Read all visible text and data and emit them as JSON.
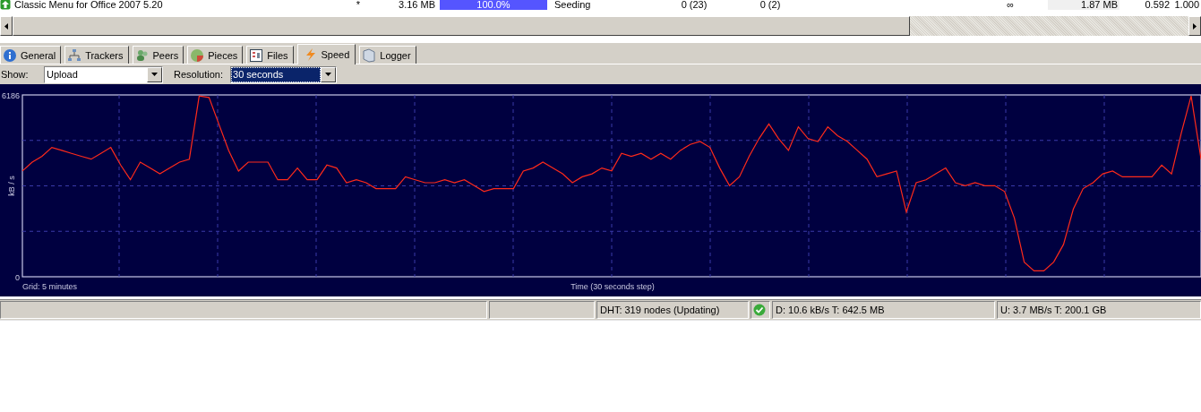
{
  "torrent_row": {
    "name": "Classic Menu for Office 2007 5.20",
    "priority": "*",
    "size": "3.16 MB",
    "progress": {
      "level": 1,
      "text": "100.0%"
    },
    "status": "Seeding",
    "seeds": "0 (23)",
    "peers": "0 (2)",
    "eta": "∞",
    "uploaded": "1.87 MB",
    "ratio": "0.592",
    "availability": "1.000"
  },
  "tabs": [
    {
      "label": "General",
      "selected": false
    },
    {
      "label": "Trackers",
      "selected": false
    },
    {
      "label": "Peers",
      "selected": false
    },
    {
      "label": "Pieces",
      "selected": false
    },
    {
      "label": "Files",
      "selected": false
    },
    {
      "label": "Speed",
      "selected": true
    },
    {
      "label": "Logger",
      "selected": false
    }
  ],
  "controls": [
    {
      "label": "Show:",
      "value": "Upload",
      "focused": false
    },
    {
      "label": "Resolution:",
      "value": "30 seconds",
      "focused": true
    }
  ],
  "chart": {
    "chart_data": {
      "type": "line",
      "ylabel": "kB / s",
      "xlabel": "Time (30 seconds step)",
      "ylim": [
        0,
        6186
      ],
      "yticks": [
        0,
        6186
      ],
      "series": [
        {
          "color": "#ff2a1a",
          "values": [
            3600,
            3900,
            4100,
            4400,
            4300,
            4200,
            4100,
            4000,
            4200,
            4400,
            3800,
            3300,
            3900,
            3700,
            3500,
            3700,
            3900,
            4000,
            6150,
            6100,
            5200,
            4300,
            3600,
            3900,
            3900,
            3900,
            3300,
            3300,
            3700,
            3300,
            3300,
            3800,
            3700,
            3200,
            3300,
            3200,
            3000,
            3000,
            3000,
            3400,
            3300,
            3200,
            3200,
            3300,
            3200,
            3300,
            3100,
            2900,
            3000,
            3000,
            3000,
            3600,
            3700,
            3900,
            3700,
            3500,
            3200,
            3400,
            3500,
            3700,
            3600,
            4200,
            4100,
            4200,
            4000,
            4200,
            4000,
            4300,
            4500,
            4600,
            4400,
            3700,
            3100,
            3400,
            4100,
            4700,
            5200,
            4700,
            4300,
            5100,
            4700,
            4600,
            5100,
            4800,
            4600,
            4300,
            4000,
            3400,
            3500,
            3600,
            2200,
            3200,
            3300,
            3500,
            3700,
            3200,
            3100,
            3200,
            3100,
            3100,
            2900,
            2000,
            500,
            200,
            200,
            500,
            1100,
            2300,
            3000,
            3200,
            3500,
            3600,
            3400,
            3400,
            3400,
            3400,
            3800,
            3500,
            4900,
            6150,
            4000
          ]
        }
      ]
    },
    "grid_note": "Grid: 5 minutes"
  },
  "status_bar": {
    "dht": "DHT: 319 nodes (Updating)",
    "connection_ok": true,
    "download": "D: 10.6 kB/s T: 642.5 MB",
    "upload": "U: 3.7 MB/s T: 200.1 GB"
  }
}
